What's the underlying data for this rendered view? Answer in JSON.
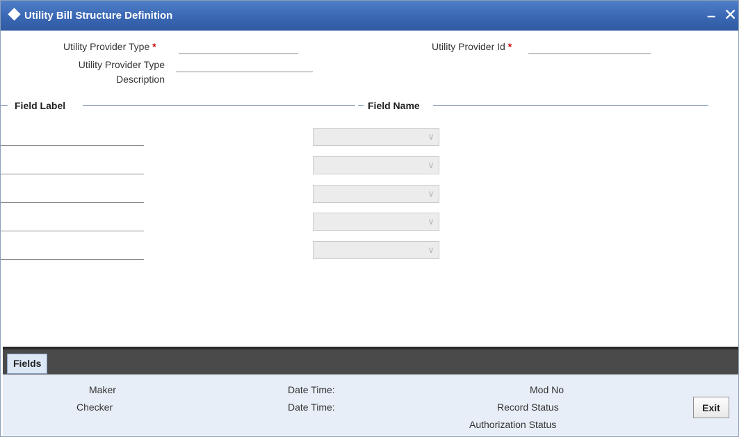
{
  "window": {
    "title": "Utility Bill Structure Definition",
    "minimize_glyph": "–",
    "close_glyph": "✕"
  },
  "header": {
    "provider_type_label": "Utility Provider Type",
    "provider_type_value": "",
    "provider_id_label": "Utility Provider Id",
    "provider_id_value": "",
    "provider_type_desc_label_line1": "Utility Provider Type",
    "provider_type_desc_label_line2": "Description",
    "provider_type_desc_value": "",
    "required_marker": "*"
  },
  "sections": {
    "field_label": "Field Label",
    "field_name": "Field Name"
  },
  "rows": [
    {
      "label": "",
      "name": ""
    },
    {
      "label": "",
      "name": ""
    },
    {
      "label": "",
      "name": ""
    },
    {
      "label": "",
      "name": ""
    },
    {
      "label": "",
      "name": ""
    }
  ],
  "tabs": {
    "fields": "Fields"
  },
  "audit": {
    "maker": "Maker",
    "checker": "Checker",
    "date_time_1": "Date Time:",
    "date_time_2": "Date Time:",
    "mod_no": "Mod No",
    "record_status": "Record Status",
    "authorization_status": "Authorization Status",
    "exit": "Exit"
  },
  "icons": {
    "dropdown": "chevron-down-icon",
    "title": "diamond-icon"
  }
}
